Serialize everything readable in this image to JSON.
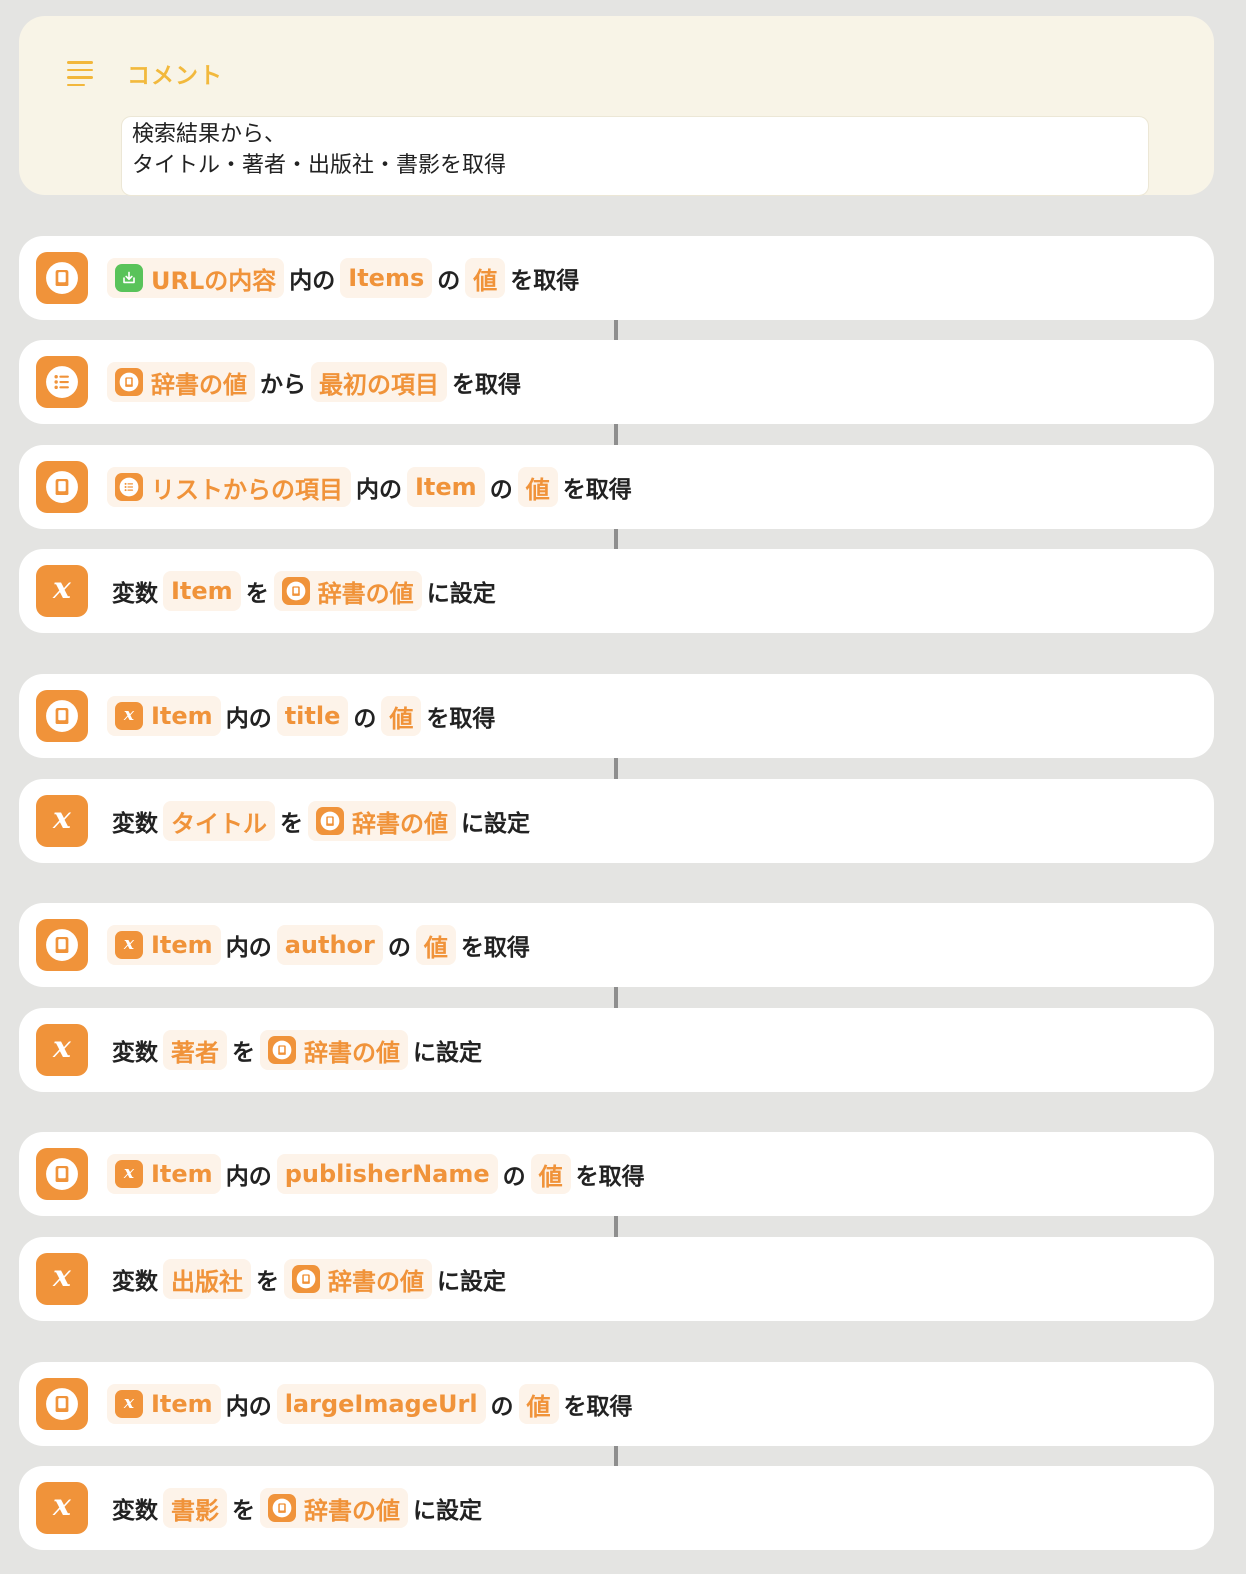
{
  "comment": {
    "title": "コメント",
    "line1": "検索結果から、",
    "line2": "タイトル・著者・出版社・書影を取得"
  },
  "colors": {
    "accent": "#f0933a",
    "comment_title": "#f2b93d",
    "green_badge": "#59c35a"
  },
  "rows": [
    {
      "icon": "dictionary-icon",
      "tokens": [
        {
          "kind": "token",
          "badge": "download-icon",
          "badge_color": "green",
          "text": "URLの内容"
        },
        {
          "kind": "text",
          "text": "内の"
        },
        {
          "kind": "token",
          "text": "Items"
        },
        {
          "kind": "text",
          "text": "の"
        },
        {
          "kind": "token",
          "text": "値"
        },
        {
          "kind": "text",
          "text": "を取得"
        }
      ]
    },
    {
      "icon": "list-icon",
      "tokens": [
        {
          "kind": "token",
          "badge": "dictionary-icon",
          "text": "辞書の値"
        },
        {
          "kind": "text",
          "text": "から"
        },
        {
          "kind": "token",
          "text": "最初の項目"
        },
        {
          "kind": "text",
          "text": "を取得"
        }
      ]
    },
    {
      "icon": "dictionary-icon",
      "tokens": [
        {
          "kind": "token",
          "badge": "list-icon",
          "text": "リストからの項目"
        },
        {
          "kind": "text",
          "text": "内の"
        },
        {
          "kind": "token",
          "text": "Item"
        },
        {
          "kind": "text",
          "text": "の"
        },
        {
          "kind": "token",
          "text": "値"
        },
        {
          "kind": "text",
          "text": "を取得"
        }
      ]
    },
    {
      "icon": "variable-icon",
      "tokens": [
        {
          "kind": "text",
          "text": "変数"
        },
        {
          "kind": "token",
          "text": "Item"
        },
        {
          "kind": "text",
          "text": "を"
        },
        {
          "kind": "token",
          "badge": "dictionary-icon",
          "text": "辞書の値"
        },
        {
          "kind": "text",
          "text": "に設定"
        }
      ]
    },
    {
      "icon": "dictionary-icon",
      "tokens": [
        {
          "kind": "token",
          "badge": "variable-icon",
          "text": "Item"
        },
        {
          "kind": "text",
          "text": "内の"
        },
        {
          "kind": "token",
          "text": "title"
        },
        {
          "kind": "text",
          "text": "の"
        },
        {
          "kind": "token",
          "text": "値"
        },
        {
          "kind": "text",
          "text": "を取得"
        }
      ]
    },
    {
      "icon": "variable-icon",
      "tokens": [
        {
          "kind": "text",
          "text": "変数"
        },
        {
          "kind": "token",
          "text": "タイトル"
        },
        {
          "kind": "text",
          "text": "を"
        },
        {
          "kind": "token",
          "badge": "dictionary-icon",
          "text": "辞書の値"
        },
        {
          "kind": "text",
          "text": "に設定"
        }
      ]
    },
    {
      "icon": "dictionary-icon",
      "tokens": [
        {
          "kind": "token",
          "badge": "variable-icon",
          "text": "Item"
        },
        {
          "kind": "text",
          "text": "内の"
        },
        {
          "kind": "token",
          "text": "author"
        },
        {
          "kind": "text",
          "text": "の"
        },
        {
          "kind": "token",
          "text": "値"
        },
        {
          "kind": "text",
          "text": "を取得"
        }
      ]
    },
    {
      "icon": "variable-icon",
      "tokens": [
        {
          "kind": "text",
          "text": "変数"
        },
        {
          "kind": "token",
          "text": "著者"
        },
        {
          "kind": "text",
          "text": "を"
        },
        {
          "kind": "token",
          "badge": "dictionary-icon",
          "text": "辞書の値"
        },
        {
          "kind": "text",
          "text": "に設定"
        }
      ]
    },
    {
      "icon": "dictionary-icon",
      "tokens": [
        {
          "kind": "token",
          "badge": "variable-icon",
          "text": "Item"
        },
        {
          "kind": "text",
          "text": "内の"
        },
        {
          "kind": "token",
          "text": "publisherName"
        },
        {
          "kind": "text",
          "text": "の"
        },
        {
          "kind": "token",
          "text": "値"
        },
        {
          "kind": "text",
          "text": "を取得"
        }
      ]
    },
    {
      "icon": "variable-icon",
      "tokens": [
        {
          "kind": "text",
          "text": "変数"
        },
        {
          "kind": "token",
          "text": "出版社"
        },
        {
          "kind": "text",
          "text": "を"
        },
        {
          "kind": "token",
          "badge": "dictionary-icon",
          "text": "辞書の値"
        },
        {
          "kind": "text",
          "text": "に設定"
        }
      ]
    },
    {
      "icon": "dictionary-icon",
      "tokens": [
        {
          "kind": "token",
          "badge": "variable-icon",
          "text": "Item"
        },
        {
          "kind": "text",
          "text": "内の"
        },
        {
          "kind": "token",
          "text": "largeImageUrl"
        },
        {
          "kind": "text",
          "text": "の"
        },
        {
          "kind": "token",
          "text": "値"
        },
        {
          "kind": "text",
          "text": "を取得"
        }
      ]
    },
    {
      "icon": "variable-icon",
      "tokens": [
        {
          "kind": "text",
          "text": "変数"
        },
        {
          "kind": "token",
          "text": "書影"
        },
        {
          "kind": "text",
          "text": "を"
        },
        {
          "kind": "token",
          "badge": "dictionary-icon",
          "text": "辞書の値"
        },
        {
          "kind": "text",
          "text": "に設定"
        }
      ]
    }
  ]
}
